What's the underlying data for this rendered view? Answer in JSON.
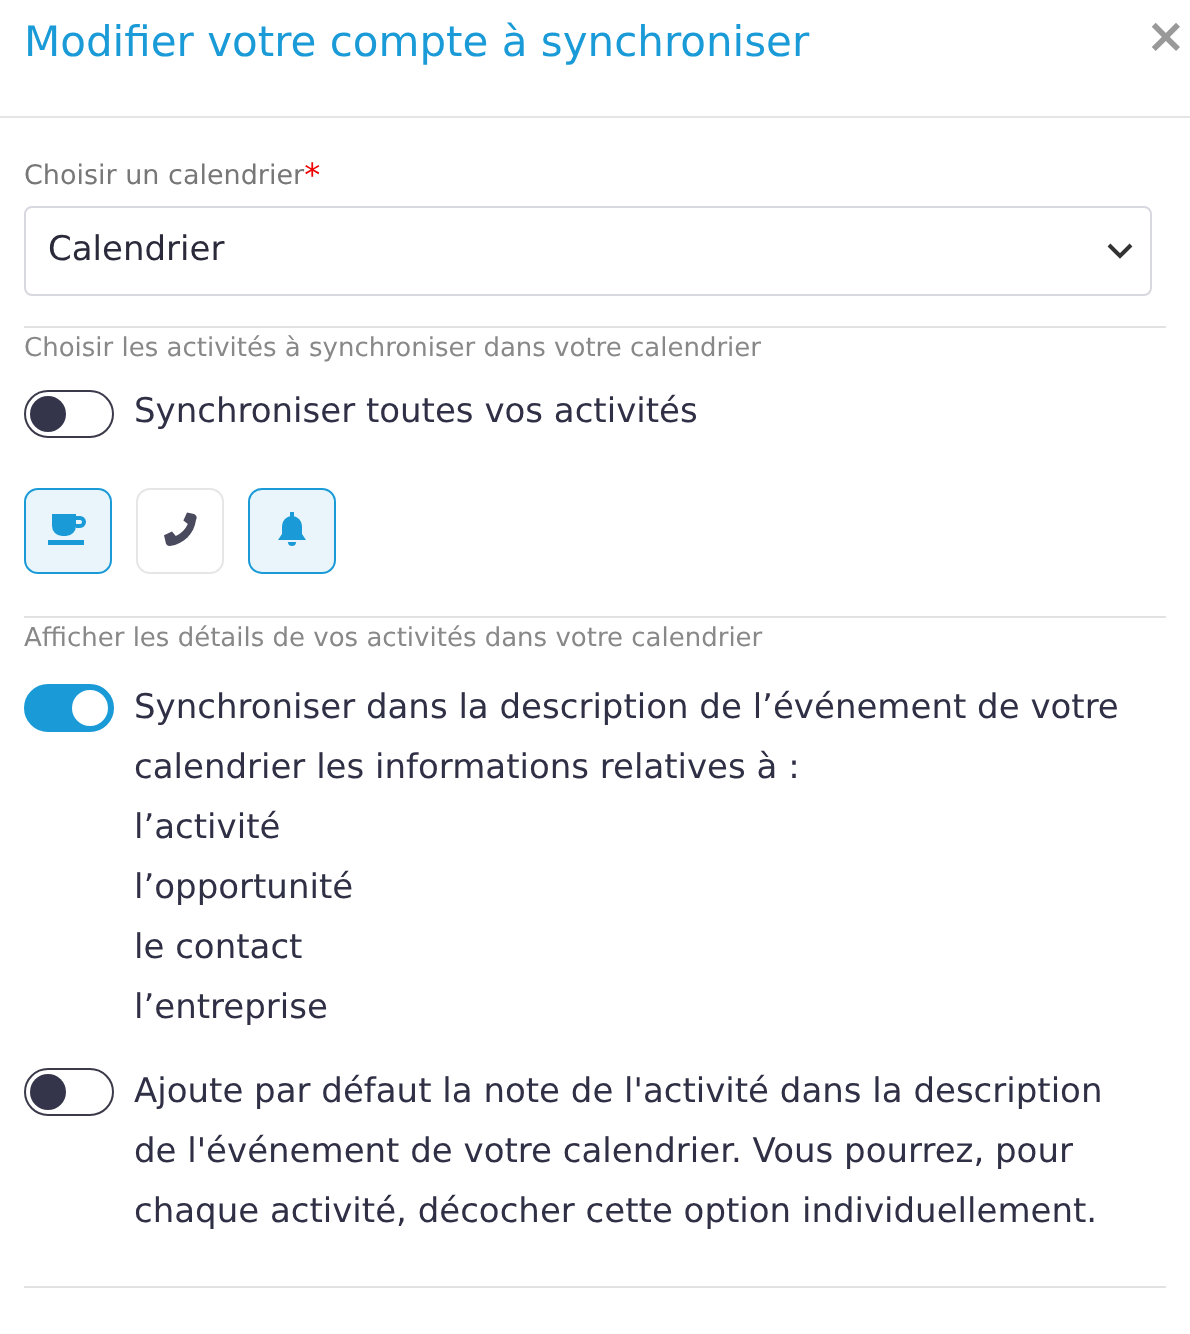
{
  "dialog": {
    "title": "Modifier votre compte à synchroniser",
    "close": "×"
  },
  "calendar_field": {
    "label": "Choisir un calendrier",
    "required_mark": "*",
    "value": "Calendrier"
  },
  "activities_section": {
    "label": "Choisir les activités à synchroniser dans votre calendrier",
    "sync_all": {
      "label": "Synchroniser toutes vos activités",
      "on": false
    },
    "activity_types": [
      {
        "kind": "coffee",
        "selected": true
      },
      {
        "kind": "phone",
        "selected": false
      },
      {
        "kind": "bell",
        "selected": true
      }
    ]
  },
  "details_section": {
    "label": "Afficher les détails de vos activités dans votre calendrier",
    "options": [
      {
        "label": "Synchroniser dans la description de l’événement de votre calendrier les informations relatives à :",
        "on": true,
        "items": [
          "l’activité",
          "l’opportunité",
          "le contact",
          "l’entreprise"
        ]
      },
      {
        "label": "Ajoute par défaut la note de l'activité dans la description de l'événement de votre calendrier. Vous pourrez, pour chaque activité, décocher cette option individuellement.",
        "on": false
      }
    ]
  }
}
